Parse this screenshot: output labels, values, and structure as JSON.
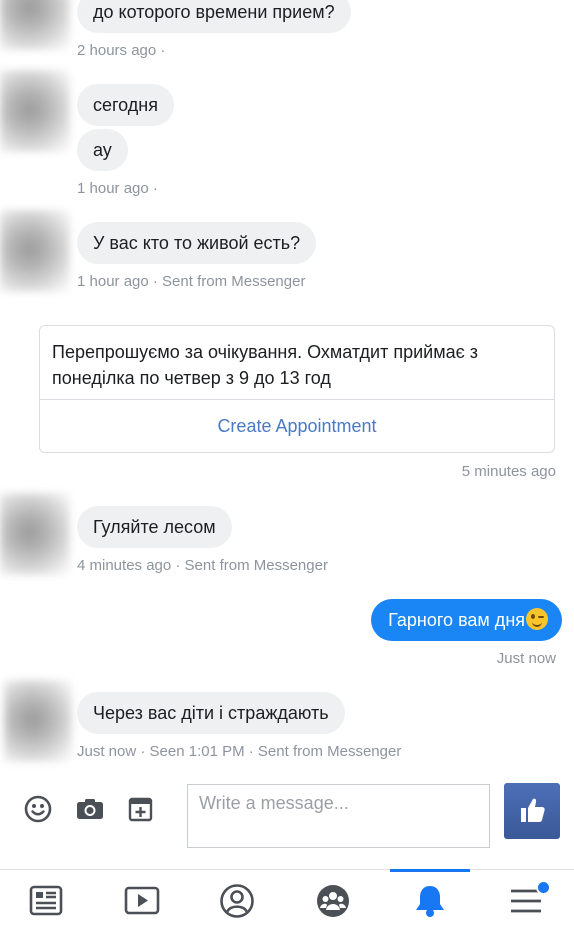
{
  "messages": {
    "m1": {
      "text": "до которого времени прием?",
      "meta": "2 hours ago ·"
    },
    "m2": {
      "text1": "сегодня",
      "text2": "ау",
      "meta": "1 hour ago ·"
    },
    "m3": {
      "text": "У вас кто то живой есть?",
      "meta": "1 hour ago · Sent from Messenger"
    },
    "reply_card": {
      "text": "Перепрошуємо за очікування. Охматдит приймає з понеділка по четвер з 9 до 13 год",
      "button": "Create Appointment",
      "meta": "5 minutes ago"
    },
    "m4": {
      "text": "Гуляйте лесом",
      "meta": "4 minutes ago · Sent from Messenger"
    },
    "outgoing": {
      "text": "Гарного вам дня",
      "meta": "Just now"
    },
    "m5": {
      "text": "Через вас діти і страждають",
      "meta": "Just now · Seen 1:01 PM · Sent from Messenger"
    }
  },
  "composer": {
    "placeholder": "Write a message...",
    "icons": [
      "smiley-icon",
      "camera-icon",
      "sticker-icon",
      "like-icon"
    ]
  },
  "tabbar": {
    "items": [
      "news-feed-icon",
      "watch-icon",
      "profile-icon",
      "groups-icon",
      "notifications-icon",
      "menu-icon"
    ],
    "active": "notifications-icon"
  },
  "colors": {
    "accent": "#1877f2",
    "outgoing_bubble": "#1a86f5",
    "incoming_bubble": "#eef0f2",
    "meta_text": "#8d949e",
    "link": "#4a7ac4"
  }
}
